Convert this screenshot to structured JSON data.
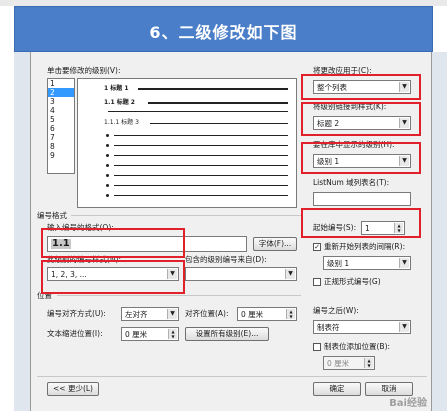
{
  "banner": {
    "title": "6、二级修改如下图"
  },
  "dialog": {
    "level_list_label": "单击要修改的级别(V):",
    "levels": [
      "1",
      "2",
      "3",
      "4",
      "5",
      "6",
      "7",
      "8",
      "9"
    ],
    "selected_level": "2",
    "preview": {
      "line1": "1 标题 1",
      "line2": "1.1 标题 2",
      "line3": "1.1.1 标题 3"
    },
    "apply_to_label": "将更改应用于(C):",
    "apply_to_value": "整个列表",
    "link_style_label": "将级别链接到样式(K):",
    "link_style_value": "标题 2",
    "gallery_level_label": "要在库中显示的级别(H):",
    "gallery_level_value": "级别 1",
    "listnum_label": "ListNum 域列表名(T):",
    "listnum_value": "",
    "number_format_section": "编号格式",
    "enter_format_label": "输入编号的格式(O):",
    "format_value": "1.1",
    "font_button": "字体(F)...",
    "number_style_label": "此级别的编号样式(N):",
    "number_style_value": "1, 2, 3, ...",
    "include_level_label": "包含的级别编号来自(D):",
    "include_level_value": "",
    "start_at_label": "起始编号(S):",
    "start_at_value": "1",
    "restart_label": "重新开始列表的间隔(R):",
    "restart_value": "级别 1",
    "legal_style_label": "正规形式编号(G)",
    "position_section": "位置",
    "alignment_label": "编号对齐方式(U):",
    "alignment_value": "左对齐",
    "aligned_at_label": "对齐位置(A):",
    "aligned_at_value": "0 厘米",
    "indent_label": "文本缩进位置(I):",
    "indent_value": "0 厘米",
    "set_all_button": "设置所有级别(E)...",
    "follow_with_label": "编号之后(W):",
    "follow_with_value": "制表符",
    "tab_stop_label": "制表位添加位置(B):",
    "tab_stop_value": "0 厘米",
    "less_button": "<< 更少(L)",
    "ok_button": "确定",
    "cancel_button": "取消"
  },
  "watermark": "Bai经验"
}
